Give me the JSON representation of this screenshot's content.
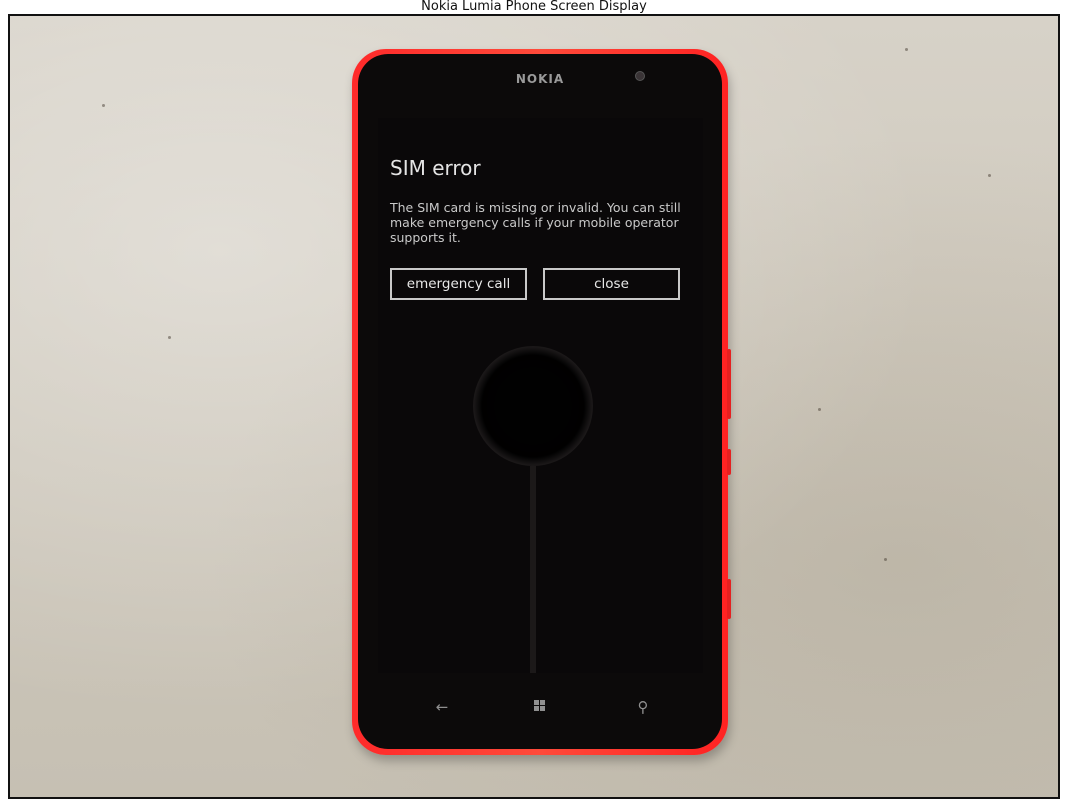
{
  "caption": "Nokia Lumia Phone Screen Display",
  "phone": {
    "brand": "NOKIA",
    "body_color": "#ff2a2a",
    "screen": {
      "title": "SIM error",
      "message": "The SIM card is missing or invalid. You can still make emergency calls if your mobile operator supports it.",
      "buttons": {
        "emergency": "emergency call",
        "close": "close"
      }
    },
    "nav": {
      "back_icon": "back-arrow-icon",
      "windows_icon": "windows-logo-icon",
      "search_icon": "search-icon",
      "back_glyph": "←",
      "search_glyph": "⚲"
    }
  }
}
